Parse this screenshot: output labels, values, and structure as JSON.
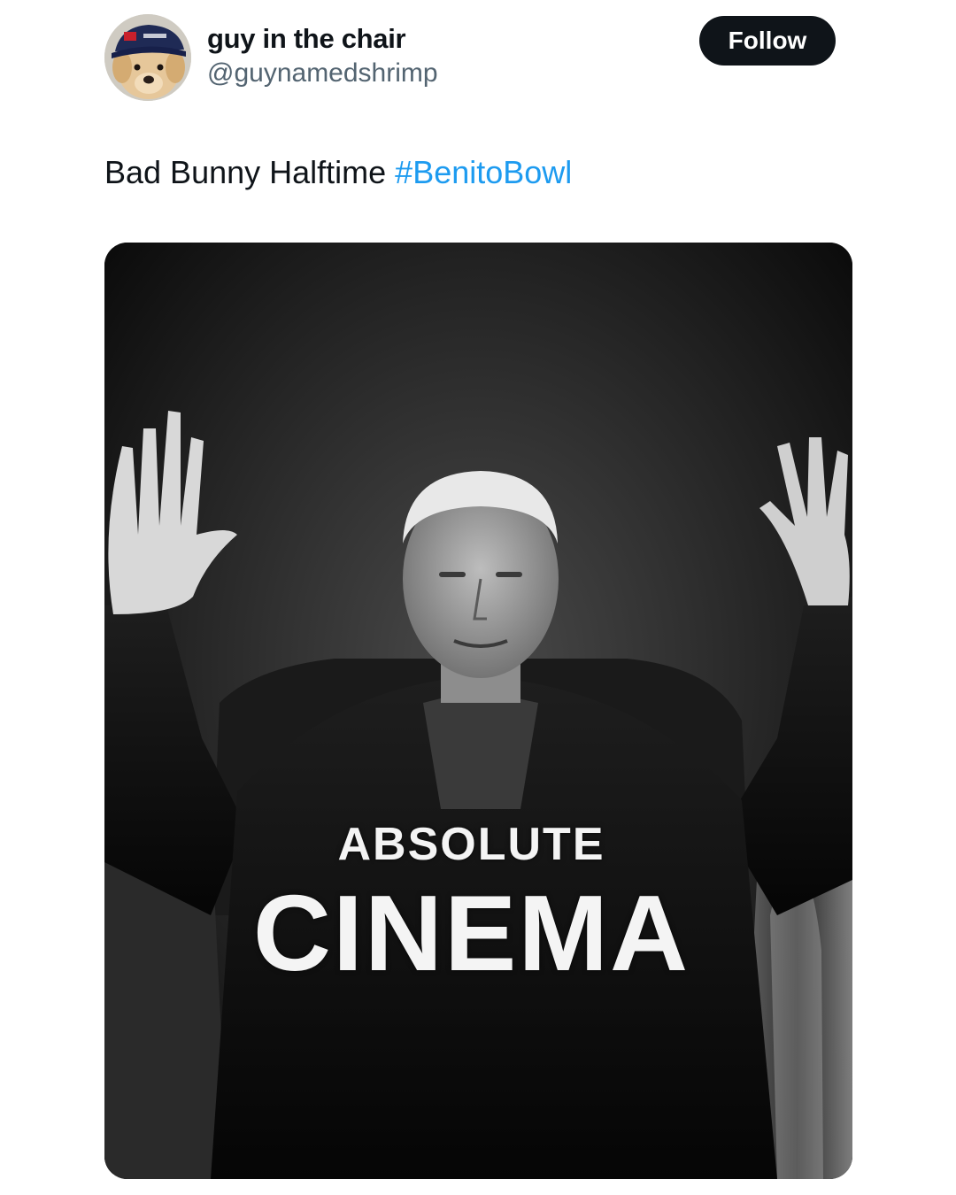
{
  "author": {
    "display_name": "guy in the chair",
    "handle": "@guynamedshrimp",
    "avatar_icon": "dog-with-cap-avatar"
  },
  "follow_button": {
    "label": "Follow"
  },
  "tweet": {
    "text": "Bad Bunny Halftime ",
    "hashtag": "#BenitoBowl"
  },
  "media": {
    "top_text": "ABSOLUTE",
    "bottom_text": "CINEMA"
  },
  "colors": {
    "text": "#0f1419",
    "secondary_text": "#536471",
    "link": "#1d9bf0",
    "button_bg": "#0f1419",
    "button_text": "#ffffff"
  }
}
